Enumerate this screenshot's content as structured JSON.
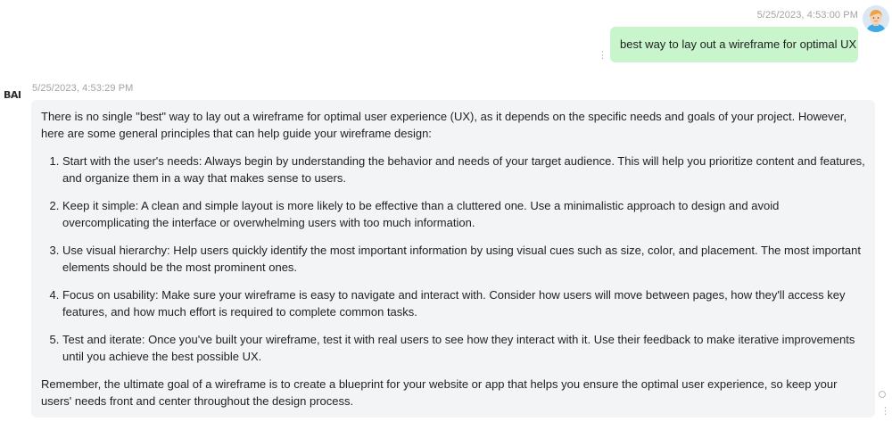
{
  "user_message": {
    "timestamp": "5/25/2023, 4:53:00 PM",
    "text": "best way to lay out a wireframe for optimal UX",
    "avatar_icon": "user-avatar-icon",
    "more_icon": "vertical-ellipsis-icon"
  },
  "bot_message": {
    "logo_text": "BAI",
    "timestamp": "5/25/2023, 4:53:29 PM",
    "intro": "There is no single \"best\" way to lay out a wireframe for optimal user experience (UX), as it depends on the specific needs and goals of your project. However, here are some general principles that can help guide your wireframe design:",
    "points": [
      "Start with the user's needs: Always begin by understanding the behavior and needs of your target audience. This will help you prioritize content and features, and organize them in a way that makes sense to users.",
      "Keep it simple: A clean and simple layout is more likely to be effective than a cluttered one. Use a minimalistic approach to design and avoid overcomplicating the interface or overwhelming users with too much information.",
      "Use visual hierarchy: Help users quickly identify the most important information by using visual cues such as size, color, and placement. The most important elements should be the most prominent ones.",
      "Focus on usability: Make sure your wireframe is easy to navigate and interact with. Consider how users will move between pages, how they'll access key features, and how much effort is required to complete common tasks.",
      "Test and iterate: Once you've built your wireframe, test it with real users to see how they interact with it. Use their feedback to make iterative improvements until you achieve the best possible UX."
    ],
    "closing": "Remember, the ultimate goal of a wireframe is to create a blueprint for your website or app that helps you ensure the optimal user experience, so keep your users' needs front and center throughout the design process.",
    "status_icon": "status-circle-icon",
    "more_icon": "vertical-ellipsis-icon"
  },
  "colors": {
    "user_bubble": "#c8f5cc",
    "bot_bubble": "#f3f4f5",
    "timestamp": "#a3a3a3"
  }
}
